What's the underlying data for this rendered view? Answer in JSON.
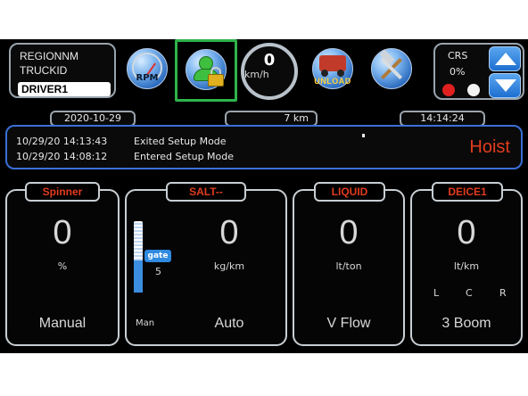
{
  "header": {
    "region": "REGIONNM",
    "truck": "TRUCKID",
    "driver": "DRIVER1"
  },
  "toolbar": {
    "rpm_label": "RPM",
    "speed_value": "0",
    "speed_unit": "km/h",
    "unload_label": "UNLOAD"
  },
  "crs": {
    "label": "CRS",
    "percent": "0%"
  },
  "status": {
    "date": "2020-10-29",
    "distance": "7 km",
    "time": "14:14:24"
  },
  "log": {
    "entries": [
      {
        "time": "10/29/20 14:13:43",
        "message": "Exited Setup Mode"
      },
      {
        "time": "10/29/20 14:08:12",
        "message": "Entered Setup Mode"
      }
    ],
    "status": "Hoist"
  },
  "panels": {
    "spinner": {
      "title": "Spinner",
      "value": "0",
      "unit": "%",
      "mode": "Manual"
    },
    "salt": {
      "title": "SALT--",
      "value": "0",
      "unit": "kg/km",
      "mode": "Auto",
      "gate_label": "gate",
      "gate_value": "5",
      "gate_level": 0.45,
      "manual_label": "Man"
    },
    "liquid": {
      "title": "LIQUID",
      "value": "0",
      "unit": "lt/ton",
      "mode": "V Flow"
    },
    "deice": {
      "title": "DEICE1",
      "value": "0",
      "unit": "lt/km",
      "mode": "3 Boom",
      "boom_left": "L",
      "boom_center": "C",
      "boom_right": "R"
    }
  },
  "colors": {
    "accent_red": "#e23c1e",
    "selected_green": "#2fb34a",
    "log_border_blue": "#3a6fd8"
  }
}
